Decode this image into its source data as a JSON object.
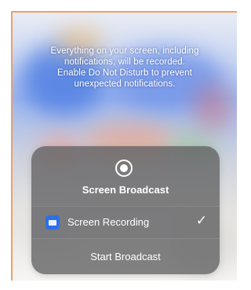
{
  "notice": {
    "lines": [
      "Everything on your screen, including",
      "notifications, will be recorded.",
      "Enable Do Not Disturb to prevent",
      "unexpected notifications."
    ]
  },
  "sheet": {
    "title": "Screen Broadcast",
    "icon": "record-icon",
    "options": [
      {
        "label": "Screen Recording",
        "icon": "screen-recording-app-icon",
        "selected": true
      }
    ],
    "start_label": "Start Broadcast",
    "check": "✓"
  },
  "colors": {
    "frame_border": "#f0a060",
    "sheet_bg": "#606062",
    "app_icon": "#2f6fe4",
    "text": "#ffffff"
  }
}
